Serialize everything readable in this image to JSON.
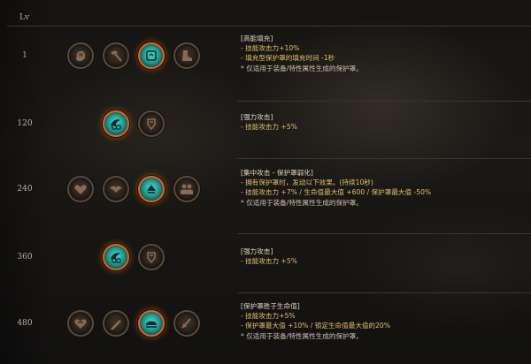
{
  "header": {
    "lv_label": "Lv"
  },
  "rows": [
    {
      "level": "1",
      "title": "[高能填充]",
      "lines": [
        {
          "kind": "bul",
          "text": "- 技能攻击力+10%"
        },
        {
          "kind": "bul",
          "text": "- 填充型保护罩的填充时间 -1秒"
        },
        {
          "kind": "note",
          "text": "* 仅适用于装备/特性属性生成的保护罩。"
        }
      ],
      "icons": [
        {
          "name": "fist-icon",
          "active": false
        },
        {
          "name": "hammer-icon",
          "active": false
        },
        {
          "name": "charge-icon",
          "active": true
        },
        {
          "name": "boot-icon",
          "active": false
        }
      ]
    },
    {
      "level": "120",
      "title": "[强力攻击]",
      "lines": [
        {
          "kind": "bul",
          "text": "- 技能攻击力 +5%"
        }
      ],
      "icons": [
        {
          "name": "power-attack-icon",
          "active": true
        },
        {
          "name": "shield-bash-icon",
          "active": false
        }
      ]
    },
    {
      "level": "240",
      "title": "[集中攻击 - 保护罩弱化]",
      "lines": [
        {
          "kind": "bul",
          "text": "- 拥有保护罩时，发动以下效果。(持续10秒)"
        },
        {
          "kind": "bul",
          "text": "- 技能攻击力 +7% / 生命值最大值 +600 / 保护罩最大值 -50%"
        },
        {
          "kind": "note",
          "text": "* 仅适用于装备/特性属性生成的保护罩。"
        }
      ],
      "icons": [
        {
          "name": "heart-icon",
          "active": false
        },
        {
          "name": "shield-wing-icon",
          "active": false
        },
        {
          "name": "focus-icon",
          "active": true
        },
        {
          "name": "group-icon",
          "active": false
        }
      ]
    },
    {
      "level": "360",
      "title": "[强力攻击]",
      "lines": [
        {
          "kind": "bul",
          "text": "- 技能攻击力 +5%"
        }
      ],
      "icons": [
        {
          "name": "power-attack-icon",
          "active": true
        },
        {
          "name": "shield-bash-icon",
          "active": false
        }
      ]
    },
    {
      "level": "480",
      "title": "[保护罩胜于生命值]",
      "lines": [
        {
          "kind": "bul",
          "text": "- 技能攻击力+5%"
        },
        {
          "kind": "bul",
          "text": "- 保护罩最大值 +10% / 锁定生命值最大值的20%"
        },
        {
          "kind": "note",
          "text": "* 仅适用于装备/特性属性生成的保护罩。"
        }
      ],
      "icons": [
        {
          "name": "heart-shield-icon",
          "active": false
        },
        {
          "name": "pen-icon",
          "active": false
        },
        {
          "name": "dome-icon",
          "active": true
        },
        {
          "name": "sword-icon",
          "active": false
        }
      ]
    }
  ],
  "colors": {
    "accent": "#e0651e",
    "active_fill": "#3fc7b8",
    "bullet": "#e2c06a",
    "text": "#d8c8b0",
    "line": "#3a3530"
  }
}
